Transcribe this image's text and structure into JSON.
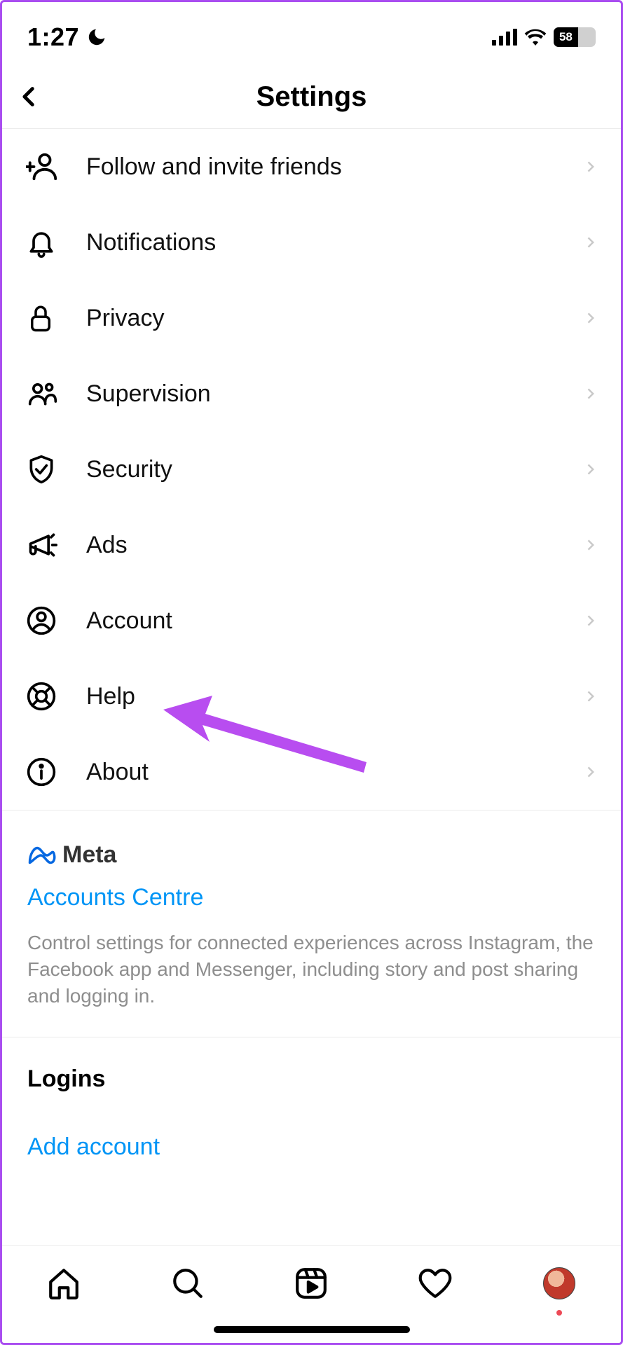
{
  "status_bar": {
    "time": "1:27",
    "battery": "58"
  },
  "header": {
    "title": "Settings"
  },
  "menu": {
    "items": [
      {
        "icon": "person-add-icon",
        "label": "Follow and invite friends"
      },
      {
        "icon": "bell-icon",
        "label": "Notifications"
      },
      {
        "icon": "lock-icon",
        "label": "Privacy"
      },
      {
        "icon": "people-icon",
        "label": "Supervision"
      },
      {
        "icon": "shield-check-icon",
        "label": "Security"
      },
      {
        "icon": "megaphone-icon",
        "label": "Ads"
      },
      {
        "icon": "account-circle-icon",
        "label": "Account"
      },
      {
        "icon": "lifebuoy-icon",
        "label": "Help"
      },
      {
        "icon": "info-icon",
        "label": "About"
      }
    ]
  },
  "meta_section": {
    "brand": "Meta",
    "link": "Accounts Centre",
    "description": "Control settings for connected experiences across Instagram, the Facebook app and Messenger, including story and post sharing and logging in."
  },
  "logins_section": {
    "title": "Logins",
    "add_account": "Add account"
  }
}
